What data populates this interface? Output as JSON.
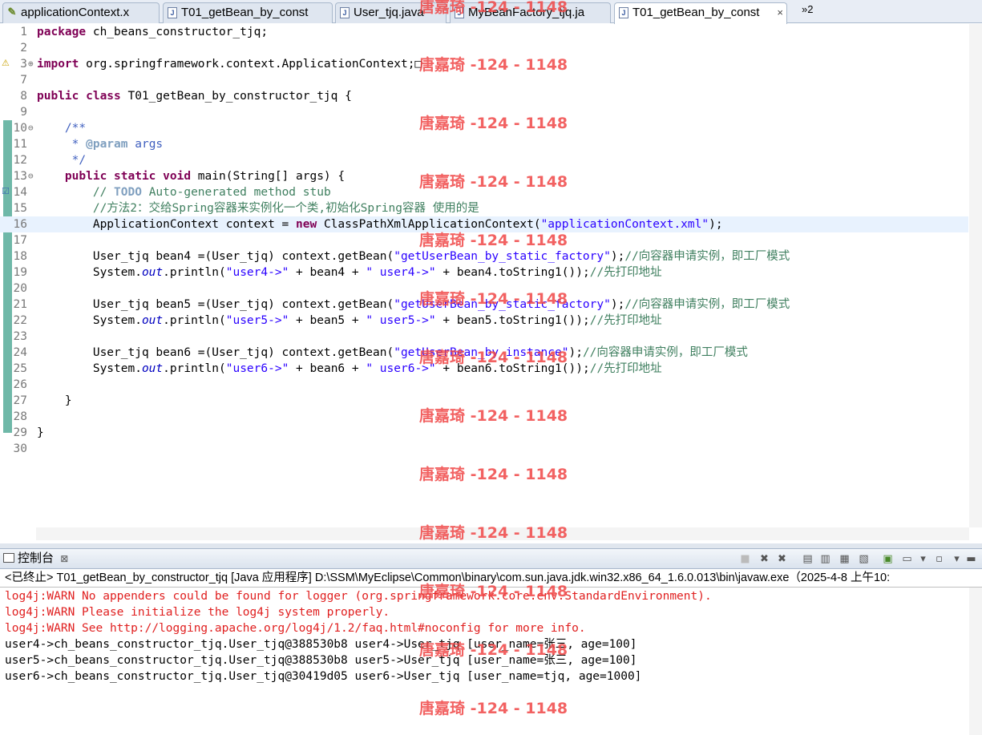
{
  "tabs": [
    {
      "label": "applicationContext.x",
      "icon": "xml-file-icon"
    },
    {
      "label": "T01_getBean_by_const",
      "icon": "java-file-icon"
    },
    {
      "label": "User_tjq.java",
      "icon": "java-file-icon"
    },
    {
      "label": "MyBeanFactory_tjq.ja",
      "icon": "java-file-icon"
    },
    {
      "label": "T01_getBean_by_const",
      "icon": "java-file-icon",
      "active": true,
      "close": "×"
    }
  ],
  "overflow_label": "»2",
  "code_lines": [
    {
      "n": "1",
      "mk": "",
      "html": "<span class='kw'>package</span> ch_beans_constructor_tjq;"
    },
    {
      "n": "2",
      "mk": "",
      "html": ""
    },
    {
      "n": "3",
      "mk": "⊕",
      "html": "<span class='kw'>import</span> org.springframework.context.ApplicationContext;□"
    },
    {
      "n": "7",
      "mk": "",
      "html": ""
    },
    {
      "n": "8",
      "mk": "",
      "html": "<span class='kw'>public class</span> T01_getBean_by_constructor_tjq {"
    },
    {
      "n": "9",
      "mk": "",
      "html": ""
    },
    {
      "n": "10",
      "mk": "⊖",
      "html": "    <span class='jd'>/**</span>"
    },
    {
      "n": "11",
      "mk": "",
      "html": "<span class='jd'>     * </span><span class='jtag'>@param</span><span class='jd'> args</span>"
    },
    {
      "n": "12",
      "mk": "",
      "html": "<span class='jd'>     */</span>"
    },
    {
      "n": "13",
      "mk": "⊖",
      "html": "    <span class='kw'>public static void</span> main(String[] args) {"
    },
    {
      "n": "14",
      "mk": "",
      "html": "        <span class='cm'>// </span><span class='todo'>TODO</span><span class='cm'> Auto-generated method stub</span>"
    },
    {
      "n": "15",
      "mk": "",
      "html": "        <span class='cm'>//方法2：交给Spring容器来实例化一个类,初始化Spring容器 使用的是</span>"
    },
    {
      "n": "16",
      "mk": "",
      "cur": true,
      "html": "        ApplicationContext context = <span class='kw'>new</span> ClassPathXmlApplicationContext(<span class='str'>\"applicationContext.xml\"</span>);"
    },
    {
      "n": "17",
      "mk": "",
      "html": ""
    },
    {
      "n": "18",
      "mk": "",
      "html": "        User_tjq bean4 =(User_tjq) context.getBean(<span class='str'>\"getUserBean_by_static_factory\"</span>);<span class='cm'>//向容器申请实例，即工厂模式</span>"
    },
    {
      "n": "19",
      "mk": "",
      "html": "        System.<span class='fld'>out</span>.println(<span class='str'>\"user4->\"</span> + bean4 + <span class='str'>\" user4->\"</span> + bean4.toString1());<span class='cm'>//先打印地址</span>"
    },
    {
      "n": "20",
      "mk": "",
      "html": ""
    },
    {
      "n": "21",
      "mk": "",
      "html": "        User_tjq bean5 =(User_tjq) context.getBean(<span class='str'>\"getUserBean_by_static_factory\"</span>);<span class='cm'>//向容器申请实例，即工厂模式</span>"
    },
    {
      "n": "22",
      "mk": "",
      "html": "        System.<span class='fld'>out</span>.println(<span class='str'>\"user5->\"</span> + bean5 + <span class='str'>\" user5->\"</span> + bean5.toString1());<span class='cm'>//先打印地址</span>"
    },
    {
      "n": "23",
      "mk": "",
      "html": ""
    },
    {
      "n": "24",
      "mk": "",
      "html": "        User_tjq bean6 =(User_tjq) context.getBean(<span class='str'>\"getUserBean_by_instance\"</span>);<span class='cm'>//向容器申请实例，即工厂模式</span>"
    },
    {
      "n": "25",
      "mk": "",
      "html": "        System.<span class='fld'>out</span>.println(<span class='str'>\"user6->\"</span> + bean6 + <span class='str'>\" user6->\"</span> + bean6.toString1());<span class='cm'>//先打印地址</span>"
    },
    {
      "n": "26",
      "mk": "",
      "html": ""
    },
    {
      "n": "27",
      "mk": "",
      "html": "    }"
    },
    {
      "n": "28",
      "mk": "",
      "html": ""
    },
    {
      "n": "29",
      "mk": "",
      "html": "}"
    },
    {
      "n": "30",
      "mk": "",
      "html": ""
    }
  ],
  "console": {
    "title": "控制台",
    "close": "⊠",
    "status": "<已终止> T01_getBean_by_constructor_tjq [Java 应用程序] D:\\SSM\\MyEclipse\\Common\\binary\\com.sun.java.jdk.win32.x86_64_1.6.0.013\\bin\\javaw.exe（2025-4-8 上午10:",
    "lines": [
      {
        "text": "log4j:WARN No appenders could be found for logger (org.springframework.core.env.StandardEnvironment).",
        "err": true
      },
      {
        "text": "log4j:WARN Please initialize the log4j system properly.",
        "err": true
      },
      {
        "text": "log4j:WARN See http://logging.apache.org/log4j/1.2/faq.html#noconfig for more info.",
        "err": true
      },
      {
        "text": "user4->ch_beans_constructor_tjq.User_tjq@388530b8 user4->User_tjq [user_name=张三, age=100]",
        "err": false
      },
      {
        "text": "user5->ch_beans_constructor_tjq.User_tjq@388530b8 user5->User_tjq [user_name=张三, age=100]",
        "err": false
      },
      {
        "text": "user6->ch_beans_constructor_tjq.User_tjq@30419d05 user6->User_tjq [user_name=tjq, age=1000]",
        "err": false
      }
    ]
  },
  "watermark": "唐嘉琦 -124 - 1148",
  "colors": {
    "keyword": "#7f0055",
    "comment": "#3f7f5f",
    "string": "#2a00ff",
    "error": "#e02020",
    "accent": "#6fb8a8"
  }
}
